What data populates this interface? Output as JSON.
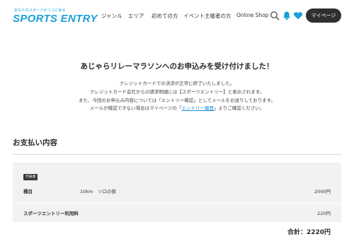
{
  "header": {
    "logo_tagline": "あなたのスポーツがココにある",
    "logo_text": "SPORTS ENTRY",
    "nav": [
      "ジャンル",
      "エリア",
      "初めての方",
      "イベント主催者の方",
      "Online Shop"
    ],
    "mypage_label": "マイページ",
    "icons": [
      "search-icon",
      "bell-icon",
      "heart-icon"
    ],
    "accent_color": "#1aa0d8"
  },
  "confirmation": {
    "title": "あじゃらリレーマラソンへのお申込みを受け付けました！",
    "line1": "クレジットカードでの決済が正常に終了いたしました。",
    "line2": "クレジットカード会社からの請求明細には【スポーツエントリー】と表示されます。",
    "line3": "また、今回のお申込み内容については「エントリー確認」としてメールをお送りしております。",
    "line4_before": "メールが確認できない場合はマイページの「",
    "line4_link": "エントリー履歴",
    "line4_after": "」よりご確認ください。"
  },
  "payment": {
    "section_title": "お支払い内容",
    "badge": "代表者",
    "item_label": "種目",
    "item_name": "10km　ソロの部",
    "item_price": "2000円",
    "fee_label": "スポーツエントリー利用料",
    "fee_price": "220円",
    "total": "合計：2220円"
  }
}
